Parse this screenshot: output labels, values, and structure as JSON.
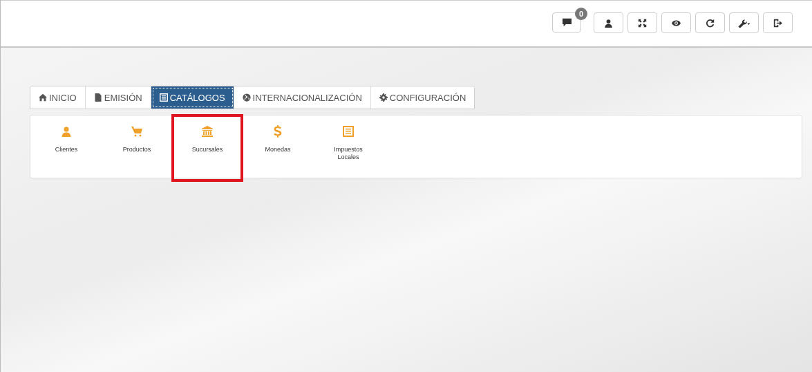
{
  "toolbar": {
    "notifications": {
      "count": "0"
    },
    "buttons": [
      {
        "kind": "user"
      },
      {
        "kind": "fullscreen"
      },
      {
        "kind": "eye"
      },
      {
        "kind": "refresh"
      },
      {
        "kind": "wrench"
      },
      {
        "kind": "logout"
      }
    ]
  },
  "tabs": [
    {
      "label": "INICIO",
      "kind": "home",
      "selected": false
    },
    {
      "label": "EMISIÓN",
      "kind": "file",
      "selected": false
    },
    {
      "label": "CATÁLOGOS",
      "kind": "list",
      "selected": true
    },
    {
      "label": "INTERNACIONALIZACIÓN",
      "kind": "globe",
      "selected": false
    },
    {
      "label": "CONFIGURACIÓN",
      "kind": "gear",
      "selected": false
    }
  ],
  "catalog_items": [
    {
      "label": "Clientes",
      "kind": "user",
      "highlighted": false
    },
    {
      "label": "Productos",
      "kind": "cart",
      "highlighted": false
    },
    {
      "label": "Sucursales",
      "kind": "bank",
      "highlighted": true
    },
    {
      "label": "Monedas",
      "kind": "dollar",
      "highlighted": false
    },
    {
      "label": "Impuestos Locales",
      "kind": "list",
      "highlighted": false
    }
  ]
}
